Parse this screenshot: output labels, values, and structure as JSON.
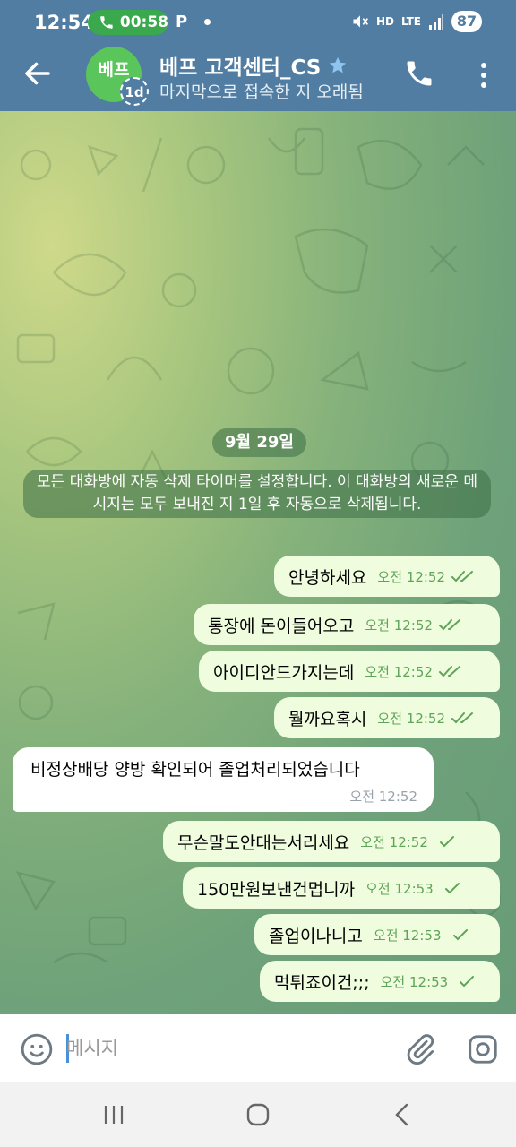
{
  "status_bar": {
    "time": "12:54",
    "call_duration": "00:58",
    "battery": "87",
    "network": "LTE",
    "hd_label": "HD"
  },
  "header": {
    "avatar_text": "베프",
    "timer_badge": "1d",
    "title": "베프 고객센터_CS",
    "subtitle": "마지막으로 접속한 지 오래됨"
  },
  "chat": {
    "date_label": "9월 29일",
    "service_message": "모든 대화방에 자동 삭제 타이머를 설정합니다. 이 대화방의 새로운 메시지는 모두 보내진 지 1일 후 자동으로 삭제됩니다.",
    "outgoing_1": [
      {
        "text": "안녕하세요",
        "time": "오전 12:52",
        "status": "read"
      },
      {
        "text": "통장에 돈이들어오고",
        "time": "오전 12:52",
        "status": "read"
      },
      {
        "text": "아이디안드가지는데",
        "time": "오전 12:52",
        "status": "read"
      },
      {
        "text": "뭘까요혹시",
        "time": "오전 12:52",
        "status": "read"
      }
    ],
    "incoming": {
      "text": "비정상배당 양방 확인되어 졸업처리되었습니다",
      "time": "오전 12:52"
    },
    "outgoing_2": [
      {
        "text": "무슨말도안대는서리세요",
        "time": "오전 12:52",
        "status": "sent"
      },
      {
        "text": "150만원보낸건멉니까",
        "time": "오전 12:53",
        "status": "sent"
      },
      {
        "text": "졸업이나니고",
        "time": "오전 12:53",
        "status": "sent"
      },
      {
        "text": "먹튀죠이건;;;",
        "time": "오전 12:53",
        "status": "sent"
      }
    ]
  },
  "input": {
    "placeholder": "메시지"
  },
  "colors": {
    "header_bg": "#527da3",
    "outgoing_bubble": "#effdde",
    "time_green": "#5fa458"
  }
}
